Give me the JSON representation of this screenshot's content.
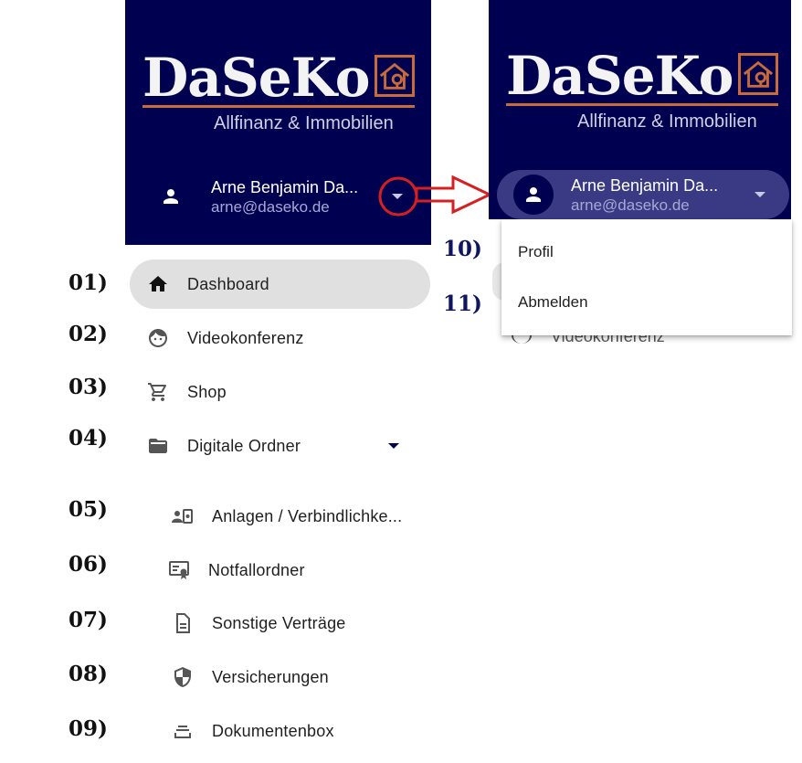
{
  "brand": {
    "name": "DaSeKo",
    "tagline": "Allfinanz & Immobilien",
    "colors": {
      "header_bg": "#000051",
      "accent": "#c96a3a",
      "callout_red": "#d42020"
    }
  },
  "user": {
    "name": "Arne Benjamin Da...",
    "email": "arne@daseko.de",
    "avatar_icon": "person-icon",
    "menu_icon": "arrow-drop-down-icon"
  },
  "annotations": [
    "01)",
    "02)",
    "03)",
    "04)",
    "05)",
    "06)",
    "07)",
    "08)",
    "09)",
    "10)",
    "11)"
  ],
  "nav": {
    "items": [
      {
        "label": "Dashboard",
        "icon": "home-icon",
        "active": true
      },
      {
        "label": "Videokonferenz",
        "icon": "face-icon"
      },
      {
        "label": "Shop",
        "icon": "cart-icon"
      },
      {
        "label": "Digitale Ordner",
        "icon": "folder-icon",
        "expand_icon": "arrow-drop-down-icon"
      }
    ],
    "subitems": [
      {
        "label": "Anlagen / Verbindlichke...",
        "icon": "contact-card-icon"
      },
      {
        "label": "Notfallordner",
        "icon": "certificate-icon"
      },
      {
        "label": "Sonstige Verträge",
        "icon": "document-icon"
      },
      {
        "label": "Versicherungen",
        "icon": "shield-icon"
      },
      {
        "label": "Dokumentenbox",
        "icon": "inbox-stack-icon"
      }
    ]
  },
  "user_menu": {
    "items": [
      {
        "label": "Profil"
      },
      {
        "label": "Abmelden"
      }
    ]
  },
  "background_text": {
    "videokonferenz_partial": "Videokonferenz"
  }
}
